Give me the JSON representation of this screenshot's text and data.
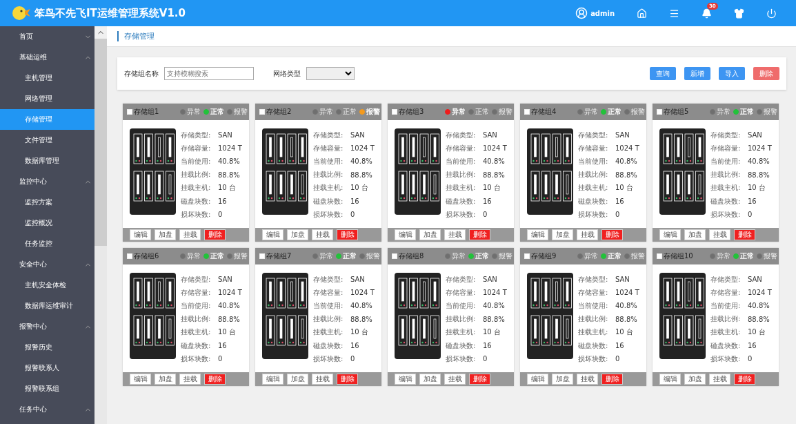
{
  "header": {
    "title": "笨鸟不先飞IT运维管理系统V1.0",
    "user": "admin",
    "notification_count": "30"
  },
  "sidebar": {
    "items": [
      {
        "label": "首页",
        "expanded": false
      },
      {
        "label": "基础运维",
        "expanded": true,
        "children": [
          {
            "label": "主机管理",
            "selected": false
          },
          {
            "label": "网络管理",
            "selected": false
          },
          {
            "label": "存储管理",
            "selected": true
          },
          {
            "label": "文件管理",
            "selected": false
          },
          {
            "label": "数据库管理",
            "selected": false
          }
        ]
      },
      {
        "label": "监控中心",
        "expanded": true,
        "children": [
          {
            "label": "监控方案",
            "selected": false
          },
          {
            "label": "监控概况",
            "selected": false
          },
          {
            "label": "任务监控",
            "selected": false
          }
        ]
      },
      {
        "label": "安全中心",
        "expanded": true,
        "children": [
          {
            "label": "主机安全体检",
            "selected": false
          },
          {
            "label": "数据库运维审计",
            "selected": false
          }
        ]
      },
      {
        "label": "报警中心",
        "expanded": true,
        "children": [
          {
            "label": "报警历史",
            "selected": false
          },
          {
            "label": "报警联系人",
            "selected": false
          },
          {
            "label": "报警联系组",
            "selected": false
          }
        ]
      },
      {
        "label": "任务中心",
        "expanded": true
      }
    ]
  },
  "breadcrumb": "存储管理",
  "filter": {
    "name_label": "存储组名称",
    "name_placeholder": "支持模糊搜索",
    "type_label": "网络类型",
    "buttons": [
      {
        "label": "查询",
        "kind": "primary"
      },
      {
        "label": "新增",
        "kind": "primary"
      },
      {
        "label": "导入",
        "kind": "primary"
      },
      {
        "label": "删除",
        "kind": "danger"
      }
    ]
  },
  "cards": [
    {
      "name": "存储组1",
      "checked": false,
      "status": [
        {
          "label": "异常",
          "kind": "abnormal",
          "selected": false
        },
        {
          "label": "正常",
          "kind": "normal",
          "selected": true
        },
        {
          "label": "报警",
          "kind": "alarm",
          "selected": false
        }
      ],
      "fields": [
        {
          "label": "存储类型:",
          "value": "SAN"
        },
        {
          "label": "存储容量:",
          "value": "1024 T"
        },
        {
          "label": "当前使用:",
          "value": "40.8%"
        },
        {
          "label": "挂载比例:",
          "value": "88.8%"
        },
        {
          "label": "挂载主机:",
          "value": "10 台"
        },
        {
          "label": "磁盘块数:",
          "value": "16"
        },
        {
          "label": "损坏块数:",
          "value": "0"
        }
      ],
      "buttons": [
        {
          "label": "编辑",
          "kind": "plain"
        },
        {
          "label": "加盘",
          "kind": "plain"
        },
        {
          "label": "挂载",
          "kind": "plain"
        },
        {
          "label": "删除",
          "kind": "danger"
        }
      ]
    },
    {
      "name": "存储组2",
      "checked": false,
      "status": [
        {
          "label": "异常",
          "kind": "abnormal",
          "selected": false
        },
        {
          "label": "正常",
          "kind": "normal",
          "selected": false
        },
        {
          "label": "报警",
          "kind": "alarm",
          "selected": true
        }
      ],
      "fields": [
        {
          "label": "存储类型:",
          "value": "SAN"
        },
        {
          "label": "存储容量:",
          "value": "1024 T"
        },
        {
          "label": "当前使用:",
          "value": "40.8%"
        },
        {
          "label": "挂载比例:",
          "value": "88.8%"
        },
        {
          "label": "挂载主机:",
          "value": "10 台"
        },
        {
          "label": "磁盘块数:",
          "value": "16"
        },
        {
          "label": "损坏块数:",
          "value": "0"
        }
      ],
      "buttons": [
        {
          "label": "编辑",
          "kind": "plain"
        },
        {
          "label": "加盘",
          "kind": "plain"
        },
        {
          "label": "挂载",
          "kind": "plain"
        },
        {
          "label": "删除",
          "kind": "danger"
        }
      ]
    },
    {
      "name": "存储组3",
      "checked": false,
      "status": [
        {
          "label": "异常",
          "kind": "abnormal",
          "selected": true
        },
        {
          "label": "正常",
          "kind": "normal",
          "selected": false
        },
        {
          "label": "报警",
          "kind": "alarm",
          "selected": false
        }
      ],
      "fields": [
        {
          "label": "存储类型:",
          "value": "SAN"
        },
        {
          "label": "存储容量:",
          "value": "1024 T"
        },
        {
          "label": "当前使用:",
          "value": "40.8%"
        },
        {
          "label": "挂载比例:",
          "value": "88.8%"
        },
        {
          "label": "挂载主机:",
          "value": "10 台"
        },
        {
          "label": "磁盘块数:",
          "value": "16"
        },
        {
          "label": "损坏块数:",
          "value": "0"
        }
      ],
      "buttons": [
        {
          "label": "编辑",
          "kind": "plain"
        },
        {
          "label": "加盘",
          "kind": "plain"
        },
        {
          "label": "挂载",
          "kind": "plain"
        },
        {
          "label": "删除",
          "kind": "danger"
        }
      ]
    },
    {
      "name": "存储组4",
      "checked": false,
      "status": [
        {
          "label": "异常",
          "kind": "abnormal",
          "selected": false
        },
        {
          "label": "正常",
          "kind": "normal",
          "selected": true
        },
        {
          "label": "报警",
          "kind": "alarm",
          "selected": false
        }
      ],
      "fields": [
        {
          "label": "存储类型:",
          "value": "SAN"
        },
        {
          "label": "存储容量:",
          "value": "1024 T"
        },
        {
          "label": "当前使用:",
          "value": "40.8%"
        },
        {
          "label": "挂载比例:",
          "value": "88.8%"
        },
        {
          "label": "挂载主机:",
          "value": "10 台"
        },
        {
          "label": "磁盘块数:",
          "value": "16"
        },
        {
          "label": "损坏块数:",
          "value": "0"
        }
      ],
      "buttons": [
        {
          "label": "编辑",
          "kind": "plain"
        },
        {
          "label": "加盘",
          "kind": "plain"
        },
        {
          "label": "挂载",
          "kind": "plain"
        },
        {
          "label": "删除",
          "kind": "danger"
        }
      ]
    },
    {
      "name": "存储组5",
      "checked": false,
      "status": [
        {
          "label": "异常",
          "kind": "abnormal",
          "selected": false
        },
        {
          "label": "正常",
          "kind": "normal",
          "selected": true
        },
        {
          "label": "报警",
          "kind": "alarm",
          "selected": false
        }
      ],
      "fields": [
        {
          "label": "存储类型:",
          "value": "SAN"
        },
        {
          "label": "存储容量:",
          "value": "1024 T"
        },
        {
          "label": "当前使用:",
          "value": "40.8%"
        },
        {
          "label": "挂载比例:",
          "value": "88.8%"
        },
        {
          "label": "挂载主机:",
          "value": "10 台"
        },
        {
          "label": "磁盘块数:",
          "value": "16"
        },
        {
          "label": "损坏块数:",
          "value": "0"
        }
      ],
      "buttons": [
        {
          "label": "编辑",
          "kind": "plain"
        },
        {
          "label": "加盘",
          "kind": "plain"
        },
        {
          "label": "挂载",
          "kind": "plain"
        },
        {
          "label": "删除",
          "kind": "danger"
        }
      ]
    },
    {
      "name": "存储组6",
      "checked": false,
      "status": [
        {
          "label": "异常",
          "kind": "abnormal",
          "selected": false
        },
        {
          "label": "正常",
          "kind": "normal",
          "selected": true
        },
        {
          "label": "报警",
          "kind": "alarm",
          "selected": false
        }
      ],
      "fields": [
        {
          "label": "存储类型:",
          "value": "SAN"
        },
        {
          "label": "存储容量:",
          "value": "1024 T"
        },
        {
          "label": "当前使用:",
          "value": "40.8%"
        },
        {
          "label": "挂载比例:",
          "value": "88.8%"
        },
        {
          "label": "挂载主机:",
          "value": "10 台"
        },
        {
          "label": "磁盘块数:",
          "value": "16"
        },
        {
          "label": "损坏块数:",
          "value": "0"
        }
      ],
      "buttons": [
        {
          "label": "编辑",
          "kind": "plain"
        },
        {
          "label": "加盘",
          "kind": "plain"
        },
        {
          "label": "挂载",
          "kind": "plain"
        },
        {
          "label": "删除",
          "kind": "danger"
        }
      ]
    },
    {
      "name": "存储组7",
      "checked": false,
      "status": [
        {
          "label": "异常",
          "kind": "abnormal",
          "selected": false
        },
        {
          "label": "正常",
          "kind": "normal",
          "selected": true
        },
        {
          "label": "报警",
          "kind": "alarm",
          "selected": false
        }
      ],
      "fields": [
        {
          "label": "存储类型:",
          "value": "SAN"
        },
        {
          "label": "存储容量:",
          "value": "1024 T"
        },
        {
          "label": "当前使用:",
          "value": "40.8%"
        },
        {
          "label": "挂载比例:",
          "value": "88.8%"
        },
        {
          "label": "挂载主机:",
          "value": "10 台"
        },
        {
          "label": "磁盘块数:",
          "value": "16"
        },
        {
          "label": "损坏块数:",
          "value": "0"
        }
      ],
      "buttons": [
        {
          "label": "编辑",
          "kind": "plain"
        },
        {
          "label": "加盘",
          "kind": "plain"
        },
        {
          "label": "挂载",
          "kind": "plain"
        },
        {
          "label": "删除",
          "kind": "danger"
        }
      ]
    },
    {
      "name": "存储组8",
      "checked": false,
      "status": [
        {
          "label": "异常",
          "kind": "abnormal",
          "selected": false
        },
        {
          "label": "正常",
          "kind": "normal",
          "selected": true
        },
        {
          "label": "报警",
          "kind": "alarm",
          "selected": false
        }
      ],
      "fields": [
        {
          "label": "存储类型:",
          "value": "SAN"
        },
        {
          "label": "存储容量:",
          "value": "1024 T"
        },
        {
          "label": "当前使用:",
          "value": "40.8%"
        },
        {
          "label": "挂载比例:",
          "value": "88.8%"
        },
        {
          "label": "挂载主机:",
          "value": "10 台"
        },
        {
          "label": "磁盘块数:",
          "value": "16"
        },
        {
          "label": "损坏块数:",
          "value": "0"
        }
      ],
      "buttons": [
        {
          "label": "编辑",
          "kind": "plain"
        },
        {
          "label": "加盘",
          "kind": "plain"
        },
        {
          "label": "挂载",
          "kind": "plain"
        },
        {
          "label": "删除",
          "kind": "danger"
        }
      ]
    },
    {
      "name": "存储组9",
      "checked": false,
      "status": [
        {
          "label": "异常",
          "kind": "abnormal",
          "selected": false
        },
        {
          "label": "正常",
          "kind": "normal",
          "selected": true
        },
        {
          "label": "报警",
          "kind": "alarm",
          "selected": false
        }
      ],
      "fields": [
        {
          "label": "存储类型:",
          "value": "SAN"
        },
        {
          "label": "存储容量:",
          "value": "1024 T"
        },
        {
          "label": "当前使用:",
          "value": "40.8%"
        },
        {
          "label": "挂载比例:",
          "value": "88.8%"
        },
        {
          "label": "挂载主机:",
          "value": "10 台"
        },
        {
          "label": "磁盘块数:",
          "value": "16"
        },
        {
          "label": "损坏块数:",
          "value": "0"
        }
      ],
      "buttons": [
        {
          "label": "编辑",
          "kind": "plain"
        },
        {
          "label": "加盘",
          "kind": "plain"
        },
        {
          "label": "挂载",
          "kind": "plain"
        },
        {
          "label": "删除",
          "kind": "danger"
        }
      ]
    },
    {
      "name": "存储组10",
      "checked": false,
      "status": [
        {
          "label": "异常",
          "kind": "abnormal",
          "selected": false
        },
        {
          "label": "正常",
          "kind": "normal",
          "selected": true
        },
        {
          "label": "报警",
          "kind": "alarm",
          "selected": false
        }
      ],
      "fields": [
        {
          "label": "存储类型:",
          "value": "SAN"
        },
        {
          "label": "存储容量:",
          "value": "1024 T"
        },
        {
          "label": "当前使用:",
          "value": "40.8%"
        },
        {
          "label": "挂载比例:",
          "value": "88.8%"
        },
        {
          "label": "挂载主机:",
          "value": "10 台"
        },
        {
          "label": "磁盘块数:",
          "value": "16"
        },
        {
          "label": "损坏块数:",
          "value": "0"
        }
      ],
      "buttons": [
        {
          "label": "编辑",
          "kind": "plain"
        },
        {
          "label": "加盘",
          "kind": "plain"
        },
        {
          "label": "挂载",
          "kind": "plain"
        },
        {
          "label": "删除",
          "kind": "danger"
        }
      ]
    }
  ]
}
